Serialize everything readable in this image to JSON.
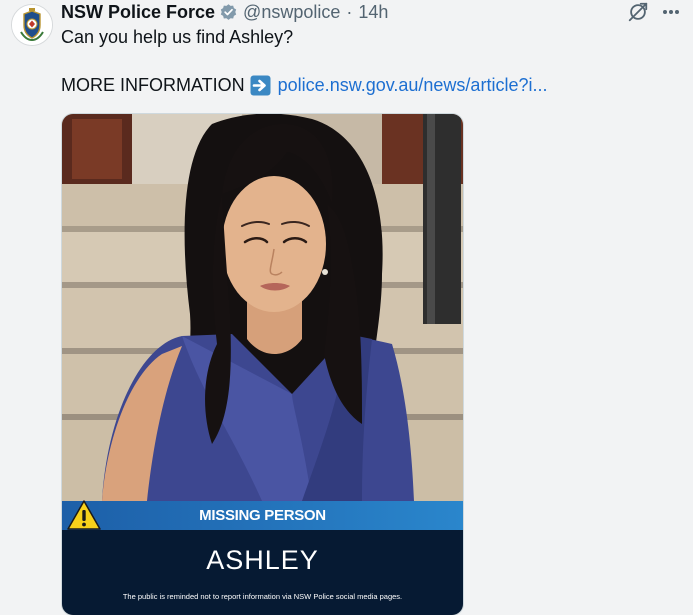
{
  "tweet": {
    "display_name": "NSW Police Force",
    "handle": "@nswpolice",
    "separator": "·",
    "time": "14h",
    "text_line1": "Can you help us find Ashley?",
    "more_info_label": "MORE INFORMATION",
    "link_text": "police.nsw.gov.au/news/article?i..."
  },
  "icons": {
    "avatar": "nsw-police-crest-icon",
    "verified": "verified-badge-icon",
    "grok": "grok-icon",
    "more": "more-options-icon",
    "arrow": "right-arrow-emoji-icon",
    "warning": "warning-triangle-icon"
  },
  "poster": {
    "banner_label": "MISSING PERSON",
    "name": "ASHLEY",
    "disclaimer": "The public is reminded not to report information via NSW Police social media pages."
  },
  "colors": {
    "link": "#1d6fd1",
    "secondary_text": "#536471",
    "verified_badge": "#829aab",
    "banner_blue": "#2a86cc",
    "panel_navy": "#061a33",
    "warning_yellow": "#f7d11b"
  }
}
